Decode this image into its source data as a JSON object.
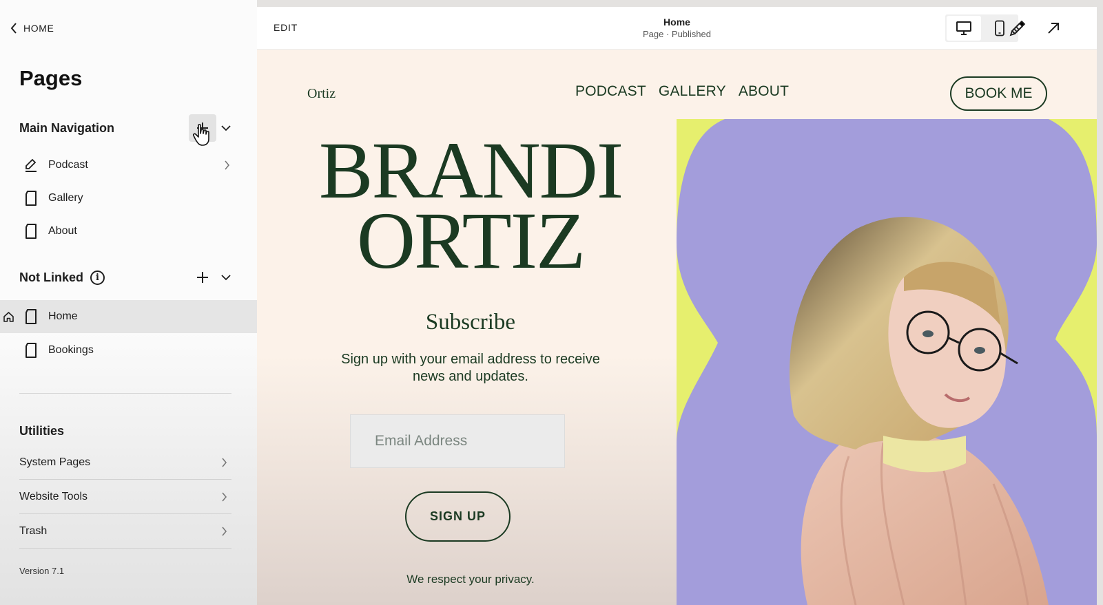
{
  "sidebar": {
    "back_label": "HOME",
    "title": "Pages",
    "main_nav": {
      "label": "Main Navigation",
      "items": [
        {
          "label": "Podcast",
          "icon": "blog-edit-icon",
          "has_children": true
        },
        {
          "label": "Gallery",
          "icon": "page-icon"
        },
        {
          "label": "About",
          "icon": "page-icon"
        }
      ]
    },
    "not_linked": {
      "label": "Not Linked",
      "items": [
        {
          "label": "Home",
          "icon": "page-icon",
          "is_homepage": true,
          "selected": true
        },
        {
          "label": "Bookings",
          "icon": "page-icon"
        }
      ]
    },
    "utilities": {
      "label": "Utilities",
      "items": [
        {
          "label": "System Pages"
        },
        {
          "label": "Website Tools"
        },
        {
          "label": "Trash"
        }
      ]
    },
    "version": "Version 7.1"
  },
  "toolbar": {
    "edit_label": "EDIT",
    "page_name": "Home",
    "page_status": "Page · Published",
    "device": "desktop"
  },
  "site": {
    "logo": "Ortiz",
    "nav": [
      "PODCAST",
      "GALLERY",
      "ABOUT"
    ],
    "cta": "BOOK ME",
    "hero_line1": "BRANDI",
    "hero_line2": "ORTIZ",
    "subscribe_title": "Subscribe",
    "subscribe_desc": "Sign up with your email address to receive news and updates.",
    "email_placeholder": "Email Address",
    "signup_label": "SIGN UP",
    "privacy": "We respect your privacy."
  },
  "colors": {
    "brand_green": "#1b3a22",
    "site_bg": "#fcf2e9",
    "lime": "#e6ef6e",
    "lavender": "#a39ddb"
  }
}
